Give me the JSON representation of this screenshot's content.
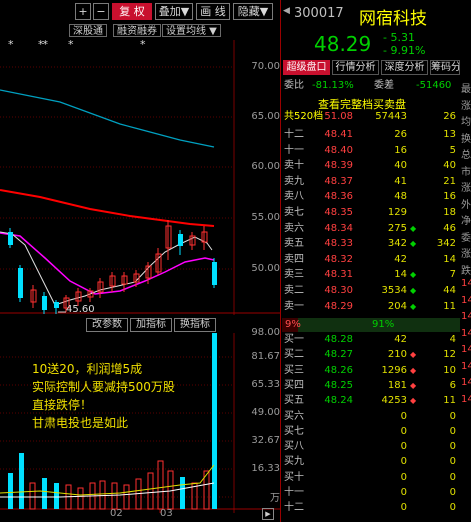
{
  "toolbar": {
    "buttons": [
      "+",
      "−",
      "复 权",
      "叠加▼",
      "画 线",
      "隐藏▼"
    ]
  },
  "sub_tabs": [
    "深股通",
    "融资融券",
    "设置均线 ▼"
  ],
  "stars": [
    "*",
    "*",
    "**",
    "*"
  ],
  "price_axis": [
    "70.00",
    "65.00",
    "60.00",
    "55.00",
    "50.00"
  ],
  "low_label": "45.60",
  "indicator_tabs": [
    "改参数",
    "加指标",
    "换指标"
  ],
  "volume_axis": [
    "98.00",
    "81.67",
    "65.33",
    "49.00",
    "32.67",
    "16.33",
    "万"
  ],
  "date_labels": [
    "02",
    "03"
  ],
  "annotation": [
    "10送20，利润增5成",
    "实际控制人要减持500万股",
    "直接跌停！",
    "甘肃电投也是如此"
  ],
  "stock": {
    "code": "300017",
    "name": "网宿科技",
    "price": "48.29",
    "change": "- 5.31",
    "pct": "- 9.91%"
  },
  "panel_tabs": [
    "超级盘口",
    "行情分析",
    "深度分析",
    "筹码分析"
  ],
  "ratio_row": {
    "label1": "委比",
    "value1": "-81.13%",
    "label2": "委差",
    "value2": "-51460"
  },
  "full_book_title": "查看完整档买卖盘",
  "total_row": {
    "label": "共520档",
    "price": "51.08",
    "vol": "57443",
    "cnt": "26"
  },
  "sell_rows": [
    {
      "label": "十二",
      "price": "48.41",
      "vol": "26",
      "arrow": "",
      "cnt": "13"
    },
    {
      "label": "十一",
      "price": "48.40",
      "vol": "16",
      "arrow": "",
      "cnt": "5"
    },
    {
      "label": "卖十",
      "price": "48.39",
      "vol": "40",
      "arrow": "",
      "cnt": "40"
    },
    {
      "label": "卖九",
      "price": "48.37",
      "vol": "41",
      "arrow": "",
      "cnt": "21"
    },
    {
      "label": "卖八",
      "price": "48.36",
      "vol": "48",
      "arrow": "",
      "cnt": "16"
    },
    {
      "label": "卖七",
      "price": "48.35",
      "vol": "129",
      "arrow": "",
      "cnt": "18"
    },
    {
      "label": "卖六",
      "price": "48.34",
      "vol": "275",
      "arrow": "◆",
      "cnt": "46"
    },
    {
      "label": "卖五",
      "price": "48.33",
      "vol": "342",
      "arrow": "◆",
      "cnt": "342"
    },
    {
      "label": "卖四",
      "price": "48.32",
      "vol": "42",
      "arrow": "",
      "cnt": "14"
    },
    {
      "label": "卖三",
      "price": "48.31",
      "vol": "14",
      "arrow": "◆",
      "cnt": "7"
    },
    {
      "label": "卖二",
      "price": "48.30",
      "vol": "3534",
      "arrow": "◆",
      "cnt": "44"
    },
    {
      "label": "卖一",
      "price": "48.29",
      "vol": "204",
      "arrow": "◆",
      "cnt": "11"
    }
  ],
  "ratio_bar": {
    "left": "9%",
    "right": "91%"
  },
  "buy_rows": [
    {
      "label": "买一",
      "price": "48.28",
      "vol": "42",
      "arrow": "",
      "cnt": "4"
    },
    {
      "label": "买二",
      "price": "48.27",
      "vol": "210",
      "arrow": "◆",
      "cnt": "12"
    },
    {
      "label": "买三",
      "price": "48.26",
      "vol": "1296",
      "arrow": "◆",
      "cnt": "10"
    },
    {
      "label": "买四",
      "price": "48.25",
      "vol": "181",
      "arrow": "◆",
      "cnt": "6"
    },
    {
      "label": "买五",
      "price": "48.24",
      "vol": "4253",
      "arrow": "◆",
      "cnt": "11"
    },
    {
      "label": "买六",
      "price": "",
      "vol": "0",
      "arrow": "",
      "cnt": "0"
    },
    {
      "label": "买七",
      "price": "",
      "vol": "0",
      "arrow": "",
      "cnt": "0"
    },
    {
      "label": "买八",
      "price": "",
      "vol": "0",
      "arrow": "",
      "cnt": "0"
    },
    {
      "label": "买九",
      "price": "",
      "vol": "0",
      "arrow": "",
      "cnt": "0"
    },
    {
      "label": "买十",
      "price": "",
      "vol": "0",
      "arrow": "",
      "cnt": "0"
    },
    {
      "label": "十一",
      "price": "",
      "vol": "0",
      "arrow": "",
      "cnt": "0"
    },
    {
      "label": "十二",
      "price": "",
      "vol": "0",
      "arrow": "",
      "cnt": "0"
    }
  ],
  "sidebar_chars": [
    "最",
    "涨",
    "均",
    "换",
    "总",
    "市",
    "涨",
    "外",
    "净",
    "委",
    "涨",
    "跌",
    "14",
    "14",
    "14",
    "14",
    "14",
    "14",
    "14",
    "14"
  ],
  "colors": {
    "up": "#ff3030",
    "down": "#00e0ff",
    "ma_white": "#e0e0e0",
    "ma_red": "#ff0000",
    "ma_magenta": "#ff00ff",
    "ma_cyan": "#00a0c0",
    "accent": "#c8102e"
  }
}
